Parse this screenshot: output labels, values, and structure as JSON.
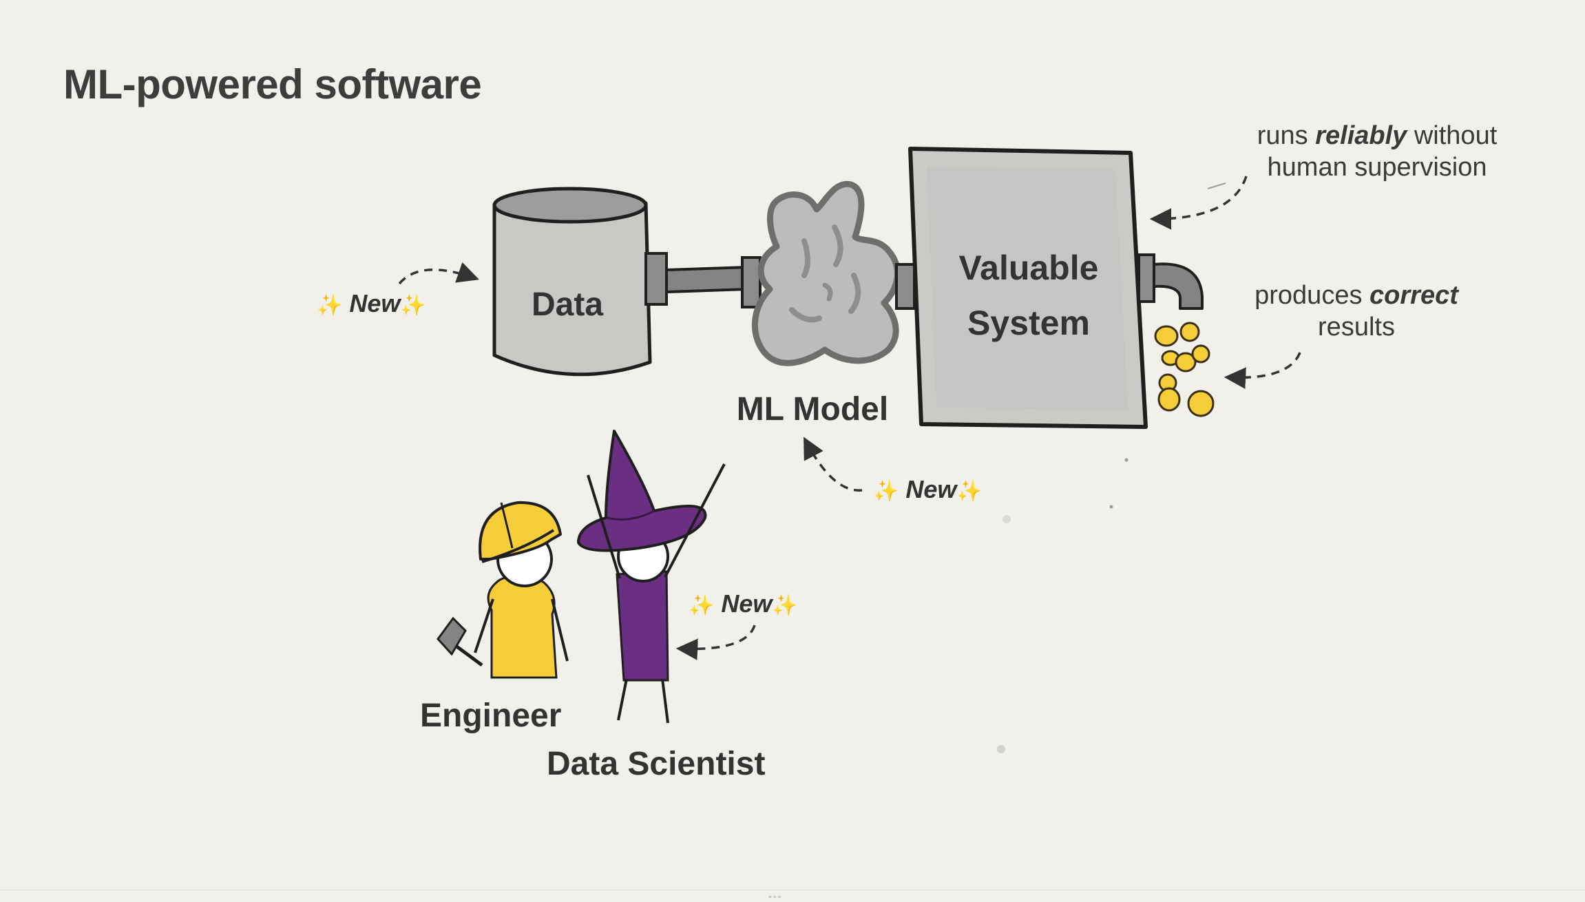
{
  "slide": {
    "title": "ML-powered software"
  },
  "diagram": {
    "data_label": "Data",
    "model_label": "ML Model",
    "system_label_line1": "Valuable",
    "system_label_line2": "System"
  },
  "annotations": {
    "reliable": {
      "pre": "runs ",
      "emphasis": "reliably",
      "post": " without",
      "line2": "human supervision"
    },
    "correct": {
      "pre": "produces ",
      "emphasis": "correct",
      "line2": "results"
    },
    "new_tag": "New",
    "sparkle": "✨"
  },
  "people": {
    "engineer": "Engineer",
    "data_scientist": "Data Scientist"
  },
  "colors": {
    "background": "#f2f0eb",
    "gray_fill": "#c8c7c4",
    "outline": "#1f1f1f",
    "gold": "#f4cd38",
    "purple": "#6a2f82"
  }
}
